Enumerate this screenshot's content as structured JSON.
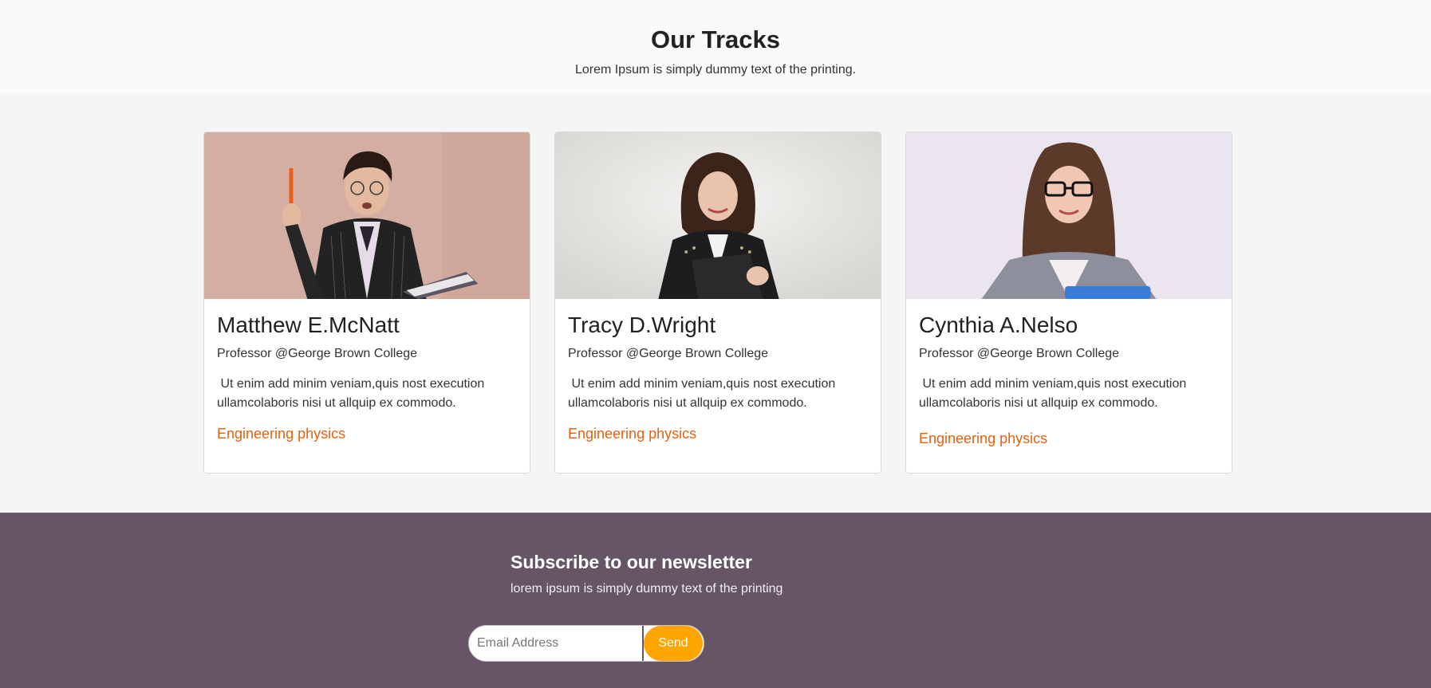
{
  "tracks": {
    "title": "Our Tracks",
    "subtitle": "Lorem Ipsum is simply dummy text of the printing."
  },
  "cards": [
    {
      "name": "Matthew E.McNatt",
      "role": "Professor @George Brown College",
      "description": " Ut enim add minim veniam,quis nost execution ullamcolaboris nisi ut allquip ex commodo.",
      "track": "Engineering physics"
    },
    {
      "name": "Tracy D.Wright",
      "role": "Professor @George Brown College",
      "description": " Ut enim add minim veniam,quis nost execution ullamcolaboris nisi ut allquip ex commodo.",
      "track": "Engineering physics"
    },
    {
      "name": "Cynthia A.Nelso",
      "role": "Professor @George Brown College",
      "description": " Ut enim add minim veniam,quis nost execution ullamcolaboris nisi ut allquip ex commodo.",
      "track": "Engineering physics"
    }
  ],
  "newsletter": {
    "title": "Subscribe to our newsletter",
    "subtitle": "lorem ipsum is simply dummy text of the printing",
    "email_placeholder": "Email Address",
    "send_label": "Send"
  },
  "colors": {
    "accent_link": "#e4620f",
    "send_button": "#ffa500",
    "newsletter_bg": "#665566"
  }
}
